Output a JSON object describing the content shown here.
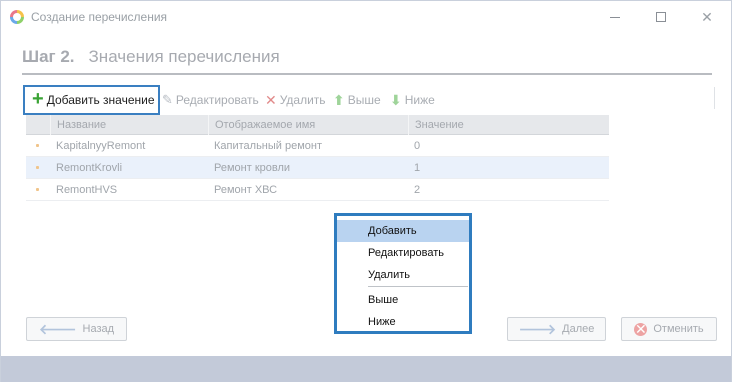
{
  "window": {
    "title": "Создание перечисления"
  },
  "step": {
    "number": "Шаг 2.",
    "title": "Значения перечисления"
  },
  "toolbar": {
    "add_label": "Добавить значение",
    "edit_label": "Редактировать",
    "delete_label": "Удалить",
    "up_label": "Выше",
    "down_label": "Ниже"
  },
  "grid": {
    "columns": [
      "Название",
      "Отображаемое имя",
      "Значение"
    ],
    "rows": [
      {
        "name": "KapitalnyyRemont",
        "display": "Капитальный ремонт",
        "value": "0"
      },
      {
        "name": "RemontKrovli",
        "display": "Ремонт кровли",
        "value": "1"
      },
      {
        "name": "RemontHVS",
        "display": "Ремонт ХВС",
        "value": "2"
      }
    ]
  },
  "context_menu": {
    "items": [
      "Добавить",
      "Редактировать",
      "Удалить",
      "Выше",
      "Ниже"
    ]
  },
  "buttons": {
    "back": "Назад",
    "next": "Далее",
    "cancel": "Отменить"
  },
  "colors": {
    "accent": "#2f7cbf",
    "selected_row": "#eaf1fb",
    "menu_highlight": "#b9d3f0",
    "footer": "#c3cad9"
  }
}
